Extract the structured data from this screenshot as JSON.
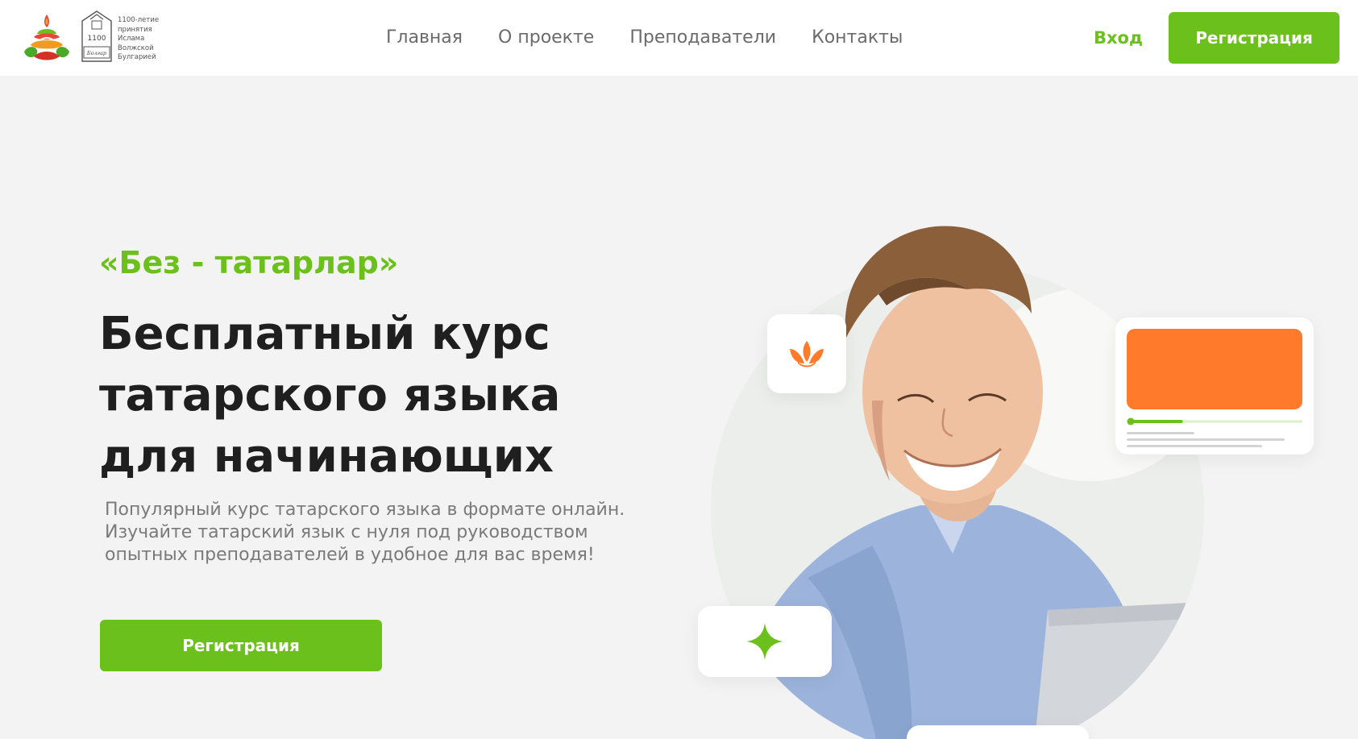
{
  "header": {
    "logo_caption": [
      "1100-летие",
      "принятия",
      "Ислама",
      "Волжской",
      "Булгарией"
    ],
    "logo_badge_number": "1100",
    "logo_badge_text": "Болгар",
    "nav": [
      {
        "label": "Главная"
      },
      {
        "label": "О проекте"
      },
      {
        "label": "Преподаватели"
      },
      {
        "label": "Контакты"
      }
    ],
    "login_label": "Вход",
    "register_label": "Регистрация"
  },
  "hero": {
    "kicker": "«Без - татарлар»",
    "title_lines": [
      "Бесплатный курс",
      "татарского языка",
      "для начинающих"
    ],
    "description_lines": [
      "Популярный курс татарского языка в формате онлайн.",
      "Изучайте татарский язык с нуля под руководством",
      "опытных преподавателей в удобное для вас время!"
    ],
    "register_label": "Регистрация",
    "video_card_progress": 0.3
  },
  "colors": {
    "accent_green": "#6cc01c",
    "accent_orange": "#ff7a2a",
    "title_dark": "#1f1f1f",
    "nav_gray": "#6b6b6b",
    "hero_bg": "#f3f3f4"
  },
  "icons": {
    "tulip": "tulip-icon",
    "star": "sparkle-star-icon",
    "logo": "tatar-ornament-logo-icon",
    "badge": "bulgar-1100-badge-icon"
  }
}
